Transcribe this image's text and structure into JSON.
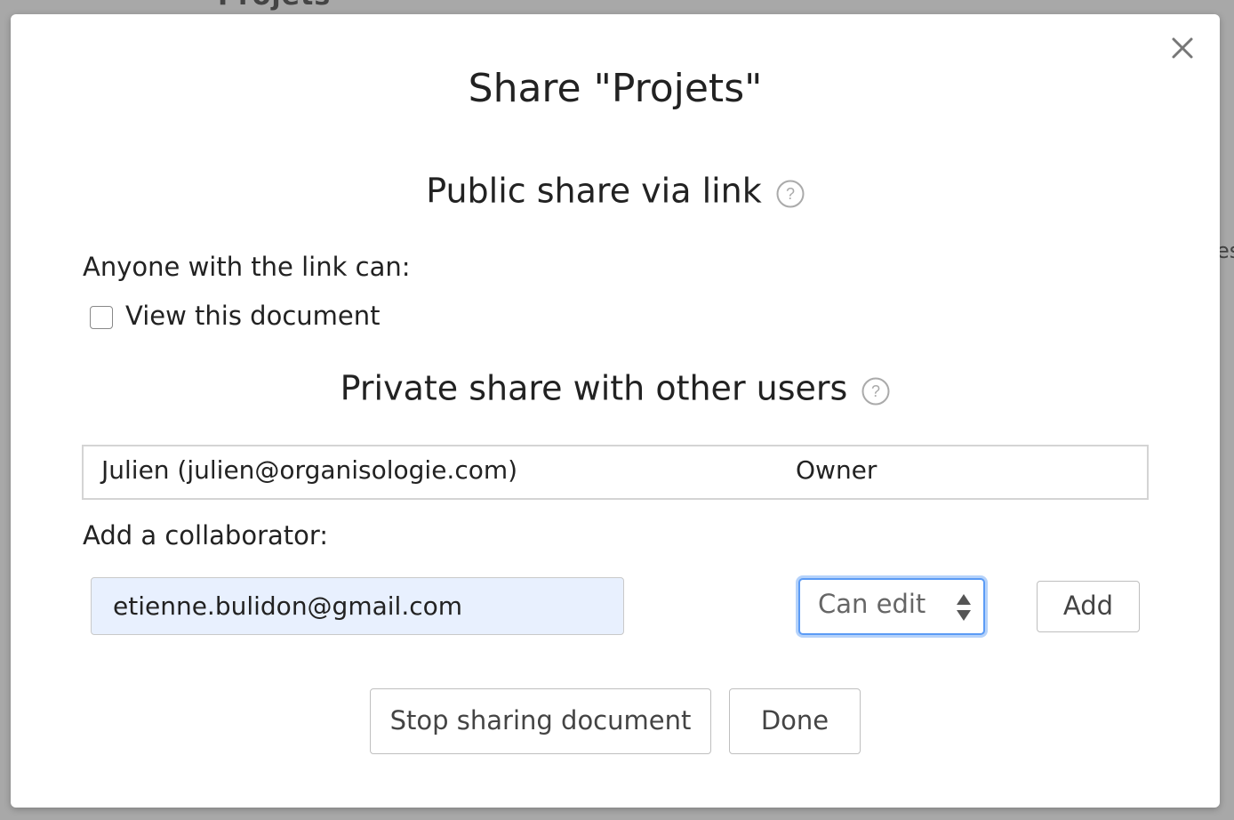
{
  "background": {
    "title_fragment": "Projets",
    "right_fragment": "es"
  },
  "modal": {
    "title": "Share \"Projets\"",
    "close_icon": "close-icon",
    "public_share": {
      "heading": "Public share via link",
      "help_icon": "help-icon",
      "anyone_label": "Anyone with the link can:",
      "view_option": {
        "label": "View this document",
        "checked": false
      }
    },
    "private_share": {
      "heading": "Private share with other users",
      "help_icon": "help-icon",
      "users": [
        {
          "name": "Julien (julien@organisologie.com)",
          "role": "Owner"
        }
      ],
      "add_label": "Add a collaborator:",
      "email_value": "etienne.bulidon@gmail.com",
      "permission": "Can edit",
      "add_button": "Add"
    },
    "footer": {
      "stop_button": "Stop sharing document",
      "done_button": "Done"
    }
  },
  "colors": {
    "overlay": "#a8a8a8",
    "focus_ring": "#5b9bf5",
    "autofill_bg": "#e8f0fe"
  }
}
